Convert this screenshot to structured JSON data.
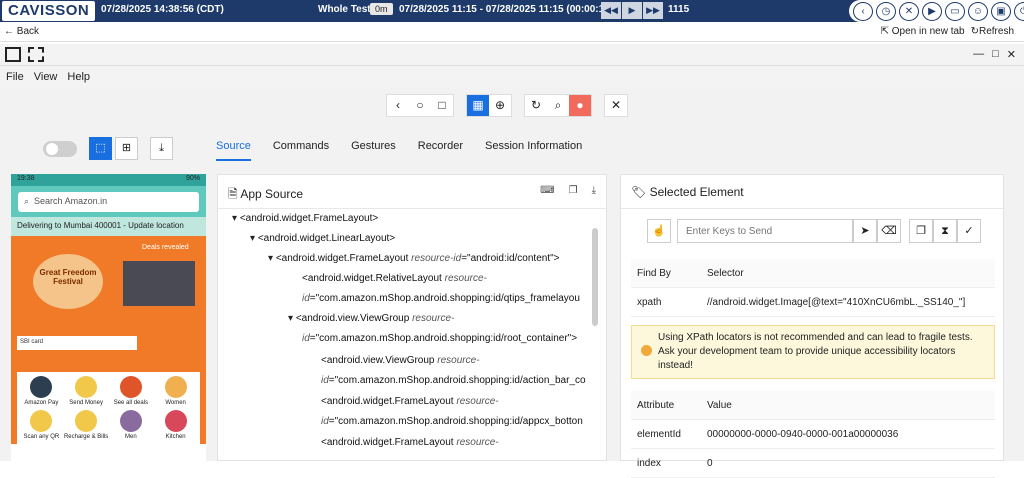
{
  "topbar": {
    "logo": "CAVISSON",
    "datetime": "07/28/2025 14:38:56 (CDT)",
    "test_label": "Whole Test",
    "badge": "0m",
    "range": "07/28/2025 11:15 - 07/28/2025 11:15 (00:00:10)",
    "count": "1115",
    "playback": [
      "◀◀",
      "▶",
      "▶▶"
    ]
  },
  "backbar": {
    "back": "Back",
    "open_new_tab": "Open in new tab",
    "refresh": "Refresh"
  },
  "menu": [
    "File",
    "View",
    "Help"
  ],
  "tabs": [
    "Source",
    "Commands",
    "Gestures",
    "Recorder",
    "Session Information"
  ],
  "phone": {
    "time": "19:38",
    "battery": "90%",
    "search_placeholder": "Search Amazon.in",
    "deliver": "Delivering to Mumbai 400001 - Update location",
    "festival": "Great Freedom Festival",
    "deals": "Deals revealed",
    "sbi": "SBI card",
    "cards": [
      "Amazon Pay",
      "Send Money",
      "See all deals",
      "Women",
      "Scan any QR",
      "Recharge & Bills",
      "Men",
      "Kitchen"
    ]
  },
  "source": {
    "title": "App Source",
    "nodes": [
      {
        "line": 1,
        "text": "<android.widget.FrameLayout>"
      },
      {
        "line": 2,
        "text": "<android.widget.LinearLayout>"
      },
      {
        "line": 3,
        "tag": "<android.widget.FrameLayout",
        "attr": "resource-id",
        "val": "=\"android:id/content\">"
      },
      {
        "line": 4,
        "tag": "<android.widget.RelativeLayout",
        "attr": "resource-",
        "val": ""
      },
      {
        "line": 5,
        "attr": "id",
        "val": "=\"com.amazon.mShop.android.shopping:id/qtips_framelayou"
      },
      {
        "line": 6,
        "tag": "<android.view.ViewGroup",
        "attr": "resource-",
        "val": ""
      },
      {
        "line": 7,
        "attr": "id",
        "val": "=\"com.amazon.mShop.android.shopping:id/root_container\">"
      },
      {
        "line": 8,
        "tag": "<android.view.ViewGroup",
        "attr": "resource-",
        "val": ""
      },
      {
        "line": 9,
        "attr": "id",
        "val": "=\"com.amazon.mShop.android.shopping:id/action_bar_co"
      },
      {
        "line": 10,
        "tag": "<android.widget.FrameLayout",
        "attr": "resource-",
        "val": ""
      },
      {
        "line": 11,
        "attr": "id",
        "val": "=\"com.amazon.mShop.android.shopping:id/appcx_botton"
      },
      {
        "line": 12,
        "tag": "<android.widget.FrameLayout",
        "attr": "resource-",
        "val": ""
      }
    ]
  },
  "selected": {
    "title": "Selected Element",
    "keys_placeholder": "Enter Keys to Send",
    "find_by_header": "Find By",
    "selector_header": "Selector",
    "find_by": "xpath",
    "selector": "//android.widget.Image[@text=\"410XnCU6mbL._SS140_\"]",
    "warning": "Using XPath locators is not recommended and can lead to fragile tests. Ask your development team to provide unique accessibility locators instead!",
    "attr_header": "Attribute",
    "value_header": "Value",
    "attributes": [
      {
        "name": "elementId",
        "value": "00000000-0000-0940-0000-001a00000036"
      },
      {
        "name": "index",
        "value": "0"
      }
    ]
  }
}
